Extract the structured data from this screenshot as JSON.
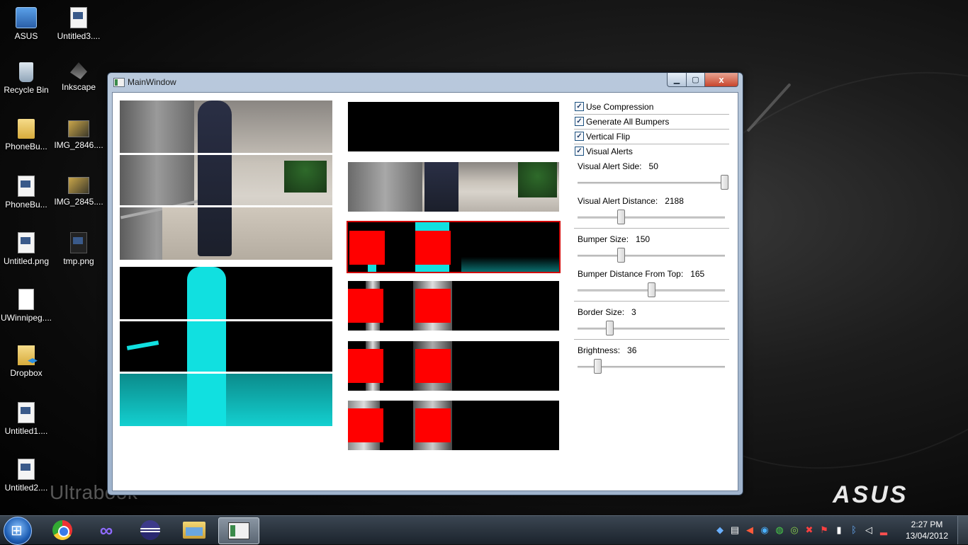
{
  "desktop": {
    "icons": [
      {
        "label": "ASUS"
      },
      {
        "label": "Untitled3...."
      },
      {
        "label": "Recycle Bin"
      },
      {
        "label": "Inkscape"
      },
      {
        "label": "PhoneBu..."
      },
      {
        "label": "IMG_2846...."
      },
      {
        "label": "PhoneBu..."
      },
      {
        "label": "IMG_2845...."
      },
      {
        "label": "Untitled.png"
      },
      {
        "label": "tmp.png"
      },
      {
        "label": "UWinnipeg...."
      },
      {
        "label": "Dropbox"
      },
      {
        "label": "Untitled1...."
      },
      {
        "label": "Untitled2...."
      }
    ],
    "watermark": "Ultrabook",
    "brand_logo": "ASUS"
  },
  "window": {
    "title": "MainWindow",
    "close_glyph": "x",
    "checkboxes": [
      {
        "label": "Use Compression",
        "checked": true
      },
      {
        "label": "Generate All Bumpers",
        "checked": true
      },
      {
        "label": "Vertical Flip",
        "checked": true
      },
      {
        "label": "Visual Alerts",
        "checked": true
      }
    ],
    "sliders": [
      {
        "label": "Visual Alert Side:",
        "value": "50"
      },
      {
        "label": "Visual Alert Distance:",
        "value": "2188"
      },
      {
        "label": "Bumper Size:",
        "value": "150"
      },
      {
        "label": "Bumper Distance From Top:",
        "value": "165"
      },
      {
        "label": "Border Size:",
        "value": "3"
      },
      {
        "label": "Brightness:",
        "value": "36"
      }
    ]
  },
  "taskbar": {
    "time": "2:27 PM",
    "date": "13/04/2012",
    "apps": [
      "start-button",
      "chrome",
      "visual-studio",
      "eclipse",
      "windows-explorer",
      "mainwindow-app"
    ]
  },
  "colors": {
    "alert_red": "#ff0000",
    "depth_cyan": "#11e0e0",
    "selection_border": "#d00000"
  }
}
